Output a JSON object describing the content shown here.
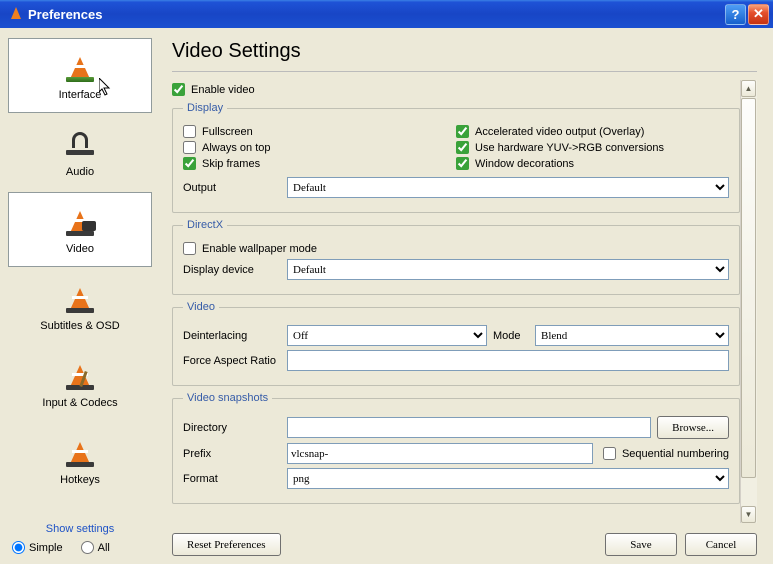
{
  "window": {
    "title": "Preferences"
  },
  "sidebar": {
    "items": [
      {
        "label": "Interface"
      },
      {
        "label": "Audio"
      },
      {
        "label": "Video"
      },
      {
        "label": "Subtitles & OSD"
      },
      {
        "label": "Input & Codecs"
      },
      {
        "label": "Hotkeys"
      }
    ],
    "show_settings_label": "Show settings",
    "radio_simple": "Simple",
    "radio_all": "All"
  },
  "page": {
    "title": "Video Settings",
    "enable_video": "Enable video",
    "display": {
      "legend": "Display",
      "fullscreen": "Fullscreen",
      "always_on_top": "Always on top",
      "skip_frames": "Skip frames",
      "accel": "Accelerated video output (Overlay)",
      "yuvrgb": "Use hardware YUV->RGB conversions",
      "windec": "Window decorations",
      "output_label": "Output",
      "output_value": "Default"
    },
    "directx": {
      "legend": "DirectX",
      "wallpaper": "Enable wallpaper mode",
      "device_label": "Display device",
      "device_value": "Default"
    },
    "video": {
      "legend": "Video",
      "deint_label": "Deinterlacing",
      "deint_value": "Off",
      "mode_label": "Mode",
      "mode_value": "Blend",
      "far_label": "Force Aspect Ratio",
      "far_value": ""
    },
    "snap": {
      "legend": "Video snapshots",
      "dir_label": "Directory",
      "dir_value": "",
      "browse": "Browse...",
      "prefix_label": "Prefix",
      "prefix_value": "vlcsnap-",
      "seq": "Sequential numbering",
      "format_label": "Format",
      "format_value": "png"
    },
    "buttons": {
      "reset": "Reset Preferences",
      "save": "Save",
      "cancel": "Cancel"
    }
  }
}
